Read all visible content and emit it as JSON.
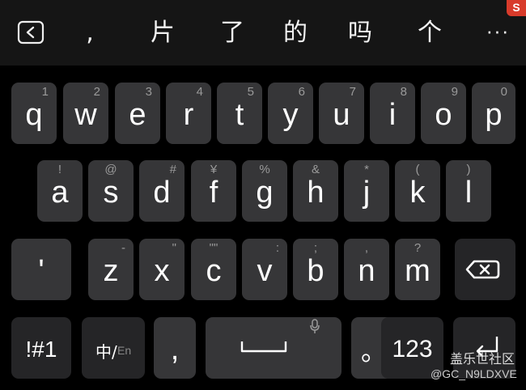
{
  "candidates": {
    "logo": "S",
    "items": [
      ",",
      "片",
      "了",
      "的",
      "吗",
      "个"
    ],
    "more": "···"
  },
  "row1": [
    {
      "label": "q",
      "hint": "1"
    },
    {
      "label": "w",
      "hint": "2"
    },
    {
      "label": "e",
      "hint": "3"
    },
    {
      "label": "r",
      "hint": "4"
    },
    {
      "label": "t",
      "hint": "5"
    },
    {
      "label": "y",
      "hint": "6"
    },
    {
      "label": "u",
      "hint": "7"
    },
    {
      "label": "i",
      "hint": "8"
    },
    {
      "label": "o",
      "hint": "9"
    },
    {
      "label": "p",
      "hint": "0"
    }
  ],
  "row2": [
    {
      "label": "a",
      "hint": "!"
    },
    {
      "label": "s",
      "hint": "@"
    },
    {
      "label": "d",
      "hint": "#"
    },
    {
      "label": "f",
      "hint": "¥"
    },
    {
      "label": "g",
      "hint": "%"
    },
    {
      "label": "h",
      "hint": "&"
    },
    {
      "label": "j",
      "hint": "*"
    },
    {
      "label": "k",
      "hint": "("
    },
    {
      "label": "l",
      "hint": ")"
    }
  ],
  "row3": {
    "apostrophe": "'",
    "letters": [
      {
        "label": "z",
        "hint": "-"
      },
      {
        "label": "x",
        "hint": "\""
      },
      {
        "label": "c",
        "hint": "\"\""
      },
      {
        "label": "v",
        "hint": ":"
      },
      {
        "label": "b",
        "hint": ";"
      },
      {
        "label": "n",
        "hint": ","
      },
      {
        "label": "m",
        "hint": "?"
      }
    ]
  },
  "row4": {
    "symbols": "!#1",
    "lang_zh": "中/",
    "lang_en": "En",
    "comma": ",",
    "period": "。",
    "numbers": "123"
  },
  "watermark": {
    "line1": "盖乐世社区",
    "line2": "@GC_N9LDXVE"
  }
}
